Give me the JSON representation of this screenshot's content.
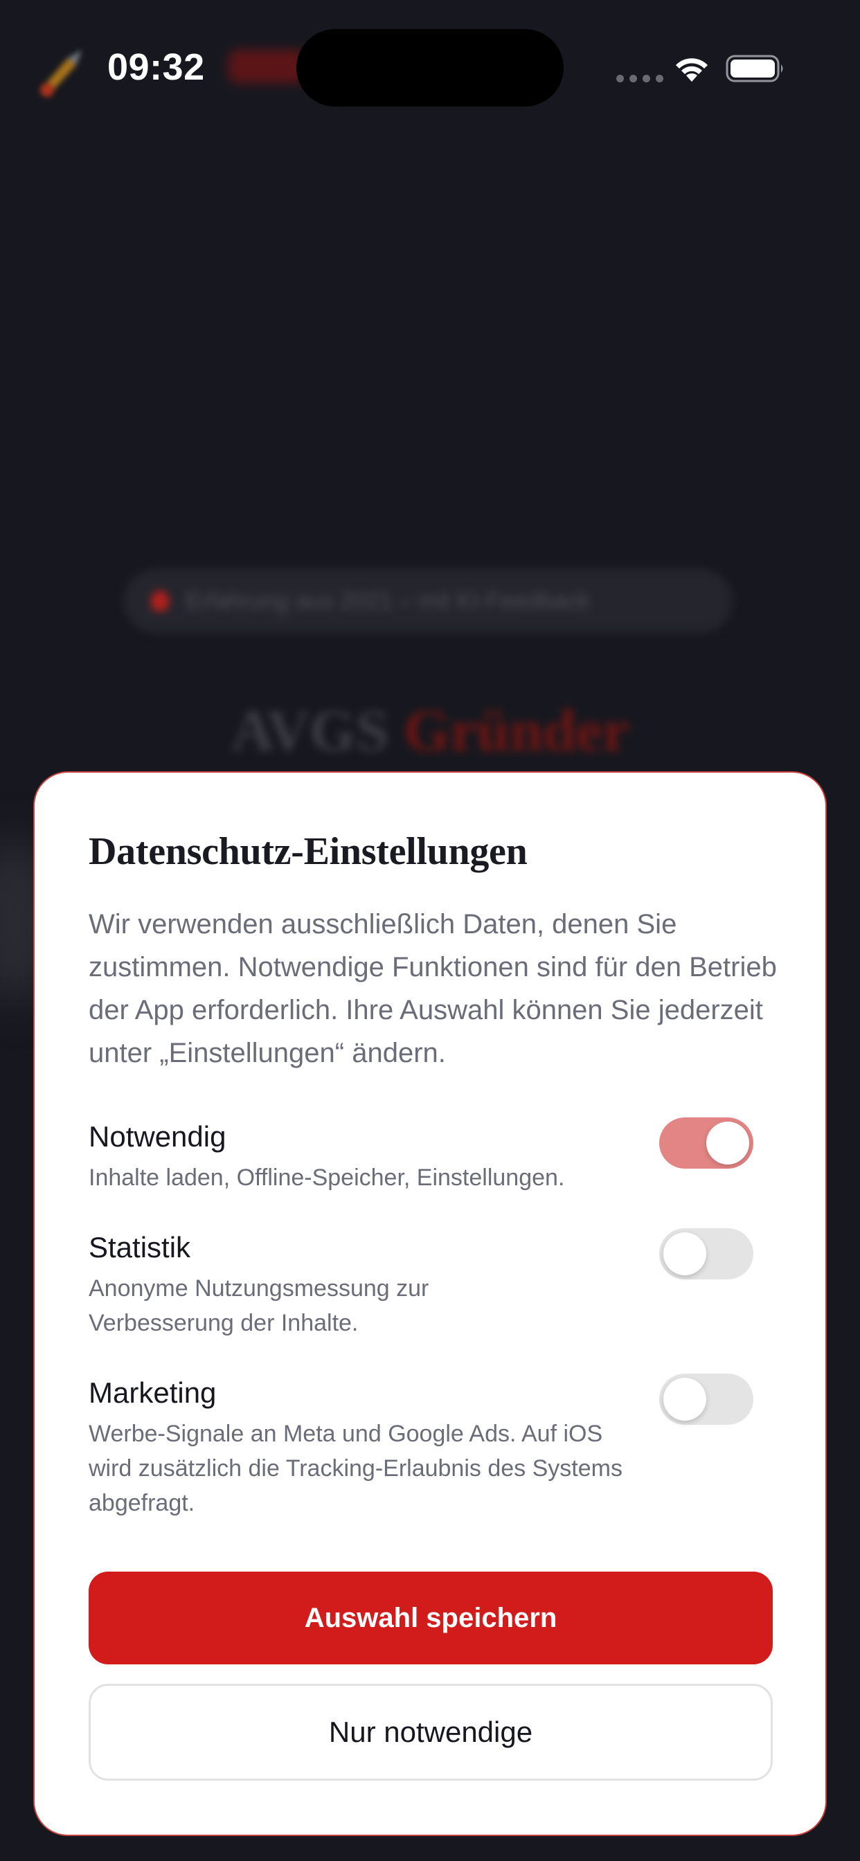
{
  "status_bar": {
    "time": "09:32",
    "icons": [
      "signal-dots-icon",
      "wifi-icon",
      "battery-icon"
    ]
  },
  "background_app": {
    "pill_text": "Erfahrung aus 2021 – mit KI-Feedback",
    "title_word_1": "AVGS",
    "title_word_2": "Gründer"
  },
  "consent": {
    "title": "Datenschutz-Einstellungen",
    "intro": "Wir verwenden ausschließlich Daten, denen Sie zustimmen. Notwendige Funktionen sind für den Betrieb der App erforderlich. Ihre Auswahl können Sie jederzeit unter „Einstellungen“ ändern.",
    "options": [
      {
        "title": "Notwendig",
        "description": "Inhalte laden, Offline-Speicher, Einstellungen.",
        "enabled": true
      },
      {
        "title": "Statistik",
        "description": "Anonyme Nutzungsmessung zur Verbesserung der Inhalte.",
        "enabled": false
      },
      {
        "title": "Marketing",
        "description": "Werbe-Signale an Meta und Google Ads. Auf iOS wird zusätzlich die Tracking-Erlaubnis des Systems abgefragt.",
        "enabled": false
      }
    ],
    "save_button_label": "Auswahl speichern",
    "necessary_only_button_label": "Nur notwendige"
  },
  "colors": {
    "accent": "#d21b1b",
    "toggle_on": "#e48585",
    "toggle_off": "#e4e4e4",
    "background": "#17181f",
    "sheet_border": "#c64040"
  }
}
